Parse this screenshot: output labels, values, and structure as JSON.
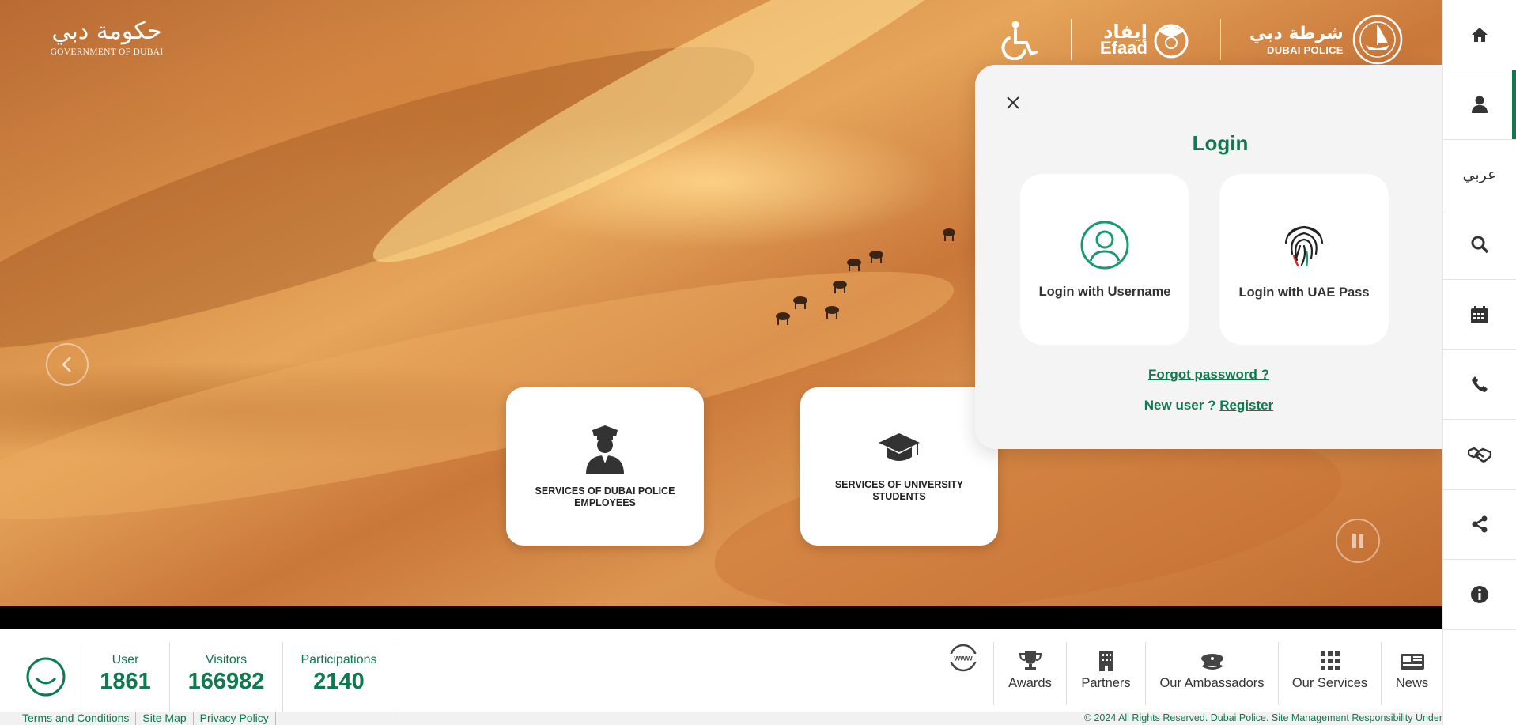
{
  "branding": {
    "gov_logo_arabic": "حكومة دبي",
    "gov_logo_english": "GOVERNMENT OF DUBAI",
    "efaad_arabic": "إيفاد",
    "efaad_english": "Efaad",
    "police_arabic": "شرطة دبي",
    "police_english": "DUBAI POLICE"
  },
  "service_cards": [
    {
      "label": "SERVICES OF DUBAI POLICE EMPLOYEES",
      "icon": "police-officer-icon"
    },
    {
      "label": "SERVICES OF UNIVERSITY STUDENTS",
      "icon": "graduation-cap-icon"
    }
  ],
  "login": {
    "title": "Login",
    "options": [
      {
        "label": "Login with Username",
        "icon": "user-circle-icon"
      },
      {
        "label": "Login with UAE Pass",
        "icon": "fingerprint-icon"
      }
    ],
    "forgot_password": "Forgot password ?",
    "new_user_text": "New user ?",
    "register_link": "Register"
  },
  "sidebar": {
    "items": [
      {
        "icon": "home-icon"
      },
      {
        "icon": "user-icon",
        "active": true
      },
      {
        "label": "عربي"
      },
      {
        "icon": "search-icon"
      },
      {
        "icon": "calendar-icon"
      },
      {
        "icon": "phone-icon"
      },
      {
        "icon": "handshake-icon"
      },
      {
        "icon": "share-icon"
      },
      {
        "icon": "info-icon"
      }
    ]
  },
  "stats": [
    {
      "label": "User",
      "value": "1861"
    },
    {
      "label": "Visitors",
      "value": "166982"
    },
    {
      "label": "Participations",
      "value": "2140"
    }
  ],
  "quick_links": [
    {
      "label": "Awards",
      "icon": "trophy-icon"
    },
    {
      "label": "Partners",
      "icon": "building-icon"
    },
    {
      "label": "Our Ambassadors",
      "icon": "officer-cap-icon"
    },
    {
      "label": "Our Services",
      "icon": "grid-icon"
    },
    {
      "label": "News",
      "icon": "newspaper-icon"
    }
  ],
  "www_label": "www",
  "footer": {
    "links": [
      "Terms and Conditions",
      "Site Map",
      "Privacy Policy"
    ],
    "copyright": "© 2024 All Rights Reserved. Dubai Police. Site Management Responsibility Under"
  },
  "colors": {
    "accent": "#0d7a4f",
    "sand": "#d58a45"
  }
}
